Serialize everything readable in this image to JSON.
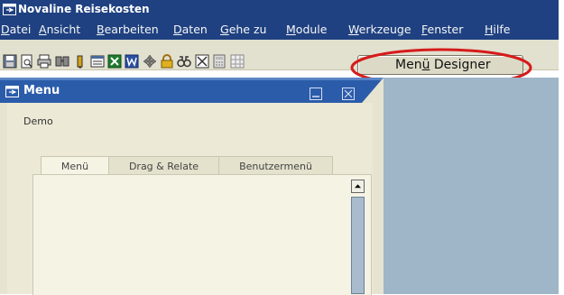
{
  "window": {
    "title": "Novaline Reisekosten"
  },
  "menu": [
    {
      "label": "Datei",
      "key": "D"
    },
    {
      "label": "Ansicht",
      "key": "A"
    },
    {
      "label": "Bearbeiten",
      "key": "B"
    },
    {
      "label": "Daten",
      "key": "D"
    },
    {
      "label": "Gehe zu",
      "key": "G"
    },
    {
      "label": "Module",
      "key": "M"
    },
    {
      "label": "Werkzeuge",
      "key": "W"
    },
    {
      "label": "Fenster",
      "key": "F"
    },
    {
      "label": "Hilfe",
      "key": "H"
    }
  ],
  "toolbar": {
    "designer_label": "Menü Designer",
    "designer_key": "ü"
  },
  "panel": {
    "title": "Menu",
    "company": "Demo",
    "tabs": [
      "Menü",
      "Drag & Relate",
      "Benutzermenü"
    ],
    "active_tab": "Menü"
  },
  "colors": {
    "titlebar": "#1f4181",
    "workspace": "#9fb5c8",
    "highlight": "#d61b1b"
  },
  "icons": [
    "save-icon",
    "print-preview-icon",
    "print-icon",
    "find-icon",
    "find-next-icon",
    "form-settings-icon",
    "excel-export-icon",
    "word-export-icon",
    "navigate-icon",
    "lock-icon",
    "binoculars-icon",
    "delete-icon",
    "calculator-icon",
    "grid-icon"
  ]
}
